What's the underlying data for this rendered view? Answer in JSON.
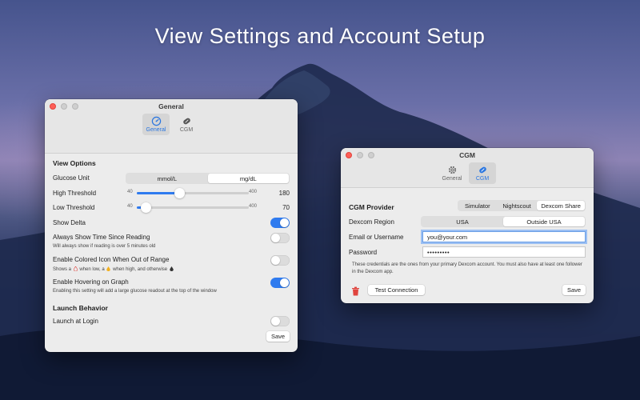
{
  "hero": {
    "title": "View Settings and Account Setup"
  },
  "general": {
    "title": "General",
    "tabs": [
      {
        "label": "General",
        "icon": "gauge-icon"
      },
      {
        "label": "CGM",
        "icon": "sensor-icon"
      }
    ],
    "view_options": {
      "heading": "View Options",
      "glucose_unit": {
        "label": "Glucose Unit",
        "options": [
          "mmol/L",
          "mg/dL"
        ],
        "selected": "mg/dL"
      },
      "high_threshold": {
        "label": "High Threshold",
        "min": "40",
        "max": "400",
        "value": "180",
        "fraction": 0.38
      },
      "low_threshold": {
        "label": "Low Threshold",
        "min": "40",
        "max": "400",
        "value": "70",
        "fraction": 0.08
      },
      "show_delta": {
        "label": "Show Delta",
        "on": true
      },
      "always_show_time": {
        "label": "Always Show Time Since Reading",
        "sub": "Will always show if reading is over 5 minutes old",
        "on": false
      },
      "colored_icon": {
        "label": "Enable Colored Icon When Out of Range",
        "sub_a": "Shows a",
        "sub_b": "when low, a",
        "sub_c": "when high, and otherwise",
        "on": false
      },
      "hovering": {
        "label": "Enable Hovering on Graph",
        "sub": "Enabling this setting will add a large glucose readout at the top of the window",
        "on": true
      }
    },
    "launch": {
      "heading": "Launch Behavior",
      "launch_at_login": {
        "label": "Launch at Login",
        "on": false
      }
    },
    "save_label": "Save"
  },
  "cgm": {
    "title": "CGM",
    "tabs": [
      {
        "label": "General",
        "icon": "gear-icon"
      },
      {
        "label": "CGM",
        "icon": "sensor-icon"
      }
    ],
    "provider": {
      "label": "CGM Provider",
      "options": [
        "Simulator",
        "Nightscout",
        "Dexcom Share"
      ],
      "selected": "Dexcom Share"
    },
    "region": {
      "label": "Dexcom Region",
      "options": [
        "USA",
        "Outside USA"
      ],
      "selected": "Outside USA"
    },
    "email": {
      "label": "Email or Username",
      "value": "you@your.com"
    },
    "password": {
      "label": "Password",
      "value": "•••••••••"
    },
    "note": "These credentials are the ones from your primary Dexcom account. You must also have at least one follower in the Dexcom app.",
    "test_label": "Test Connection",
    "save_label": "Save"
  },
  "colors": {
    "accent": "#2f7bef",
    "close": "#fe5f57",
    "delete": "#e0443e"
  }
}
